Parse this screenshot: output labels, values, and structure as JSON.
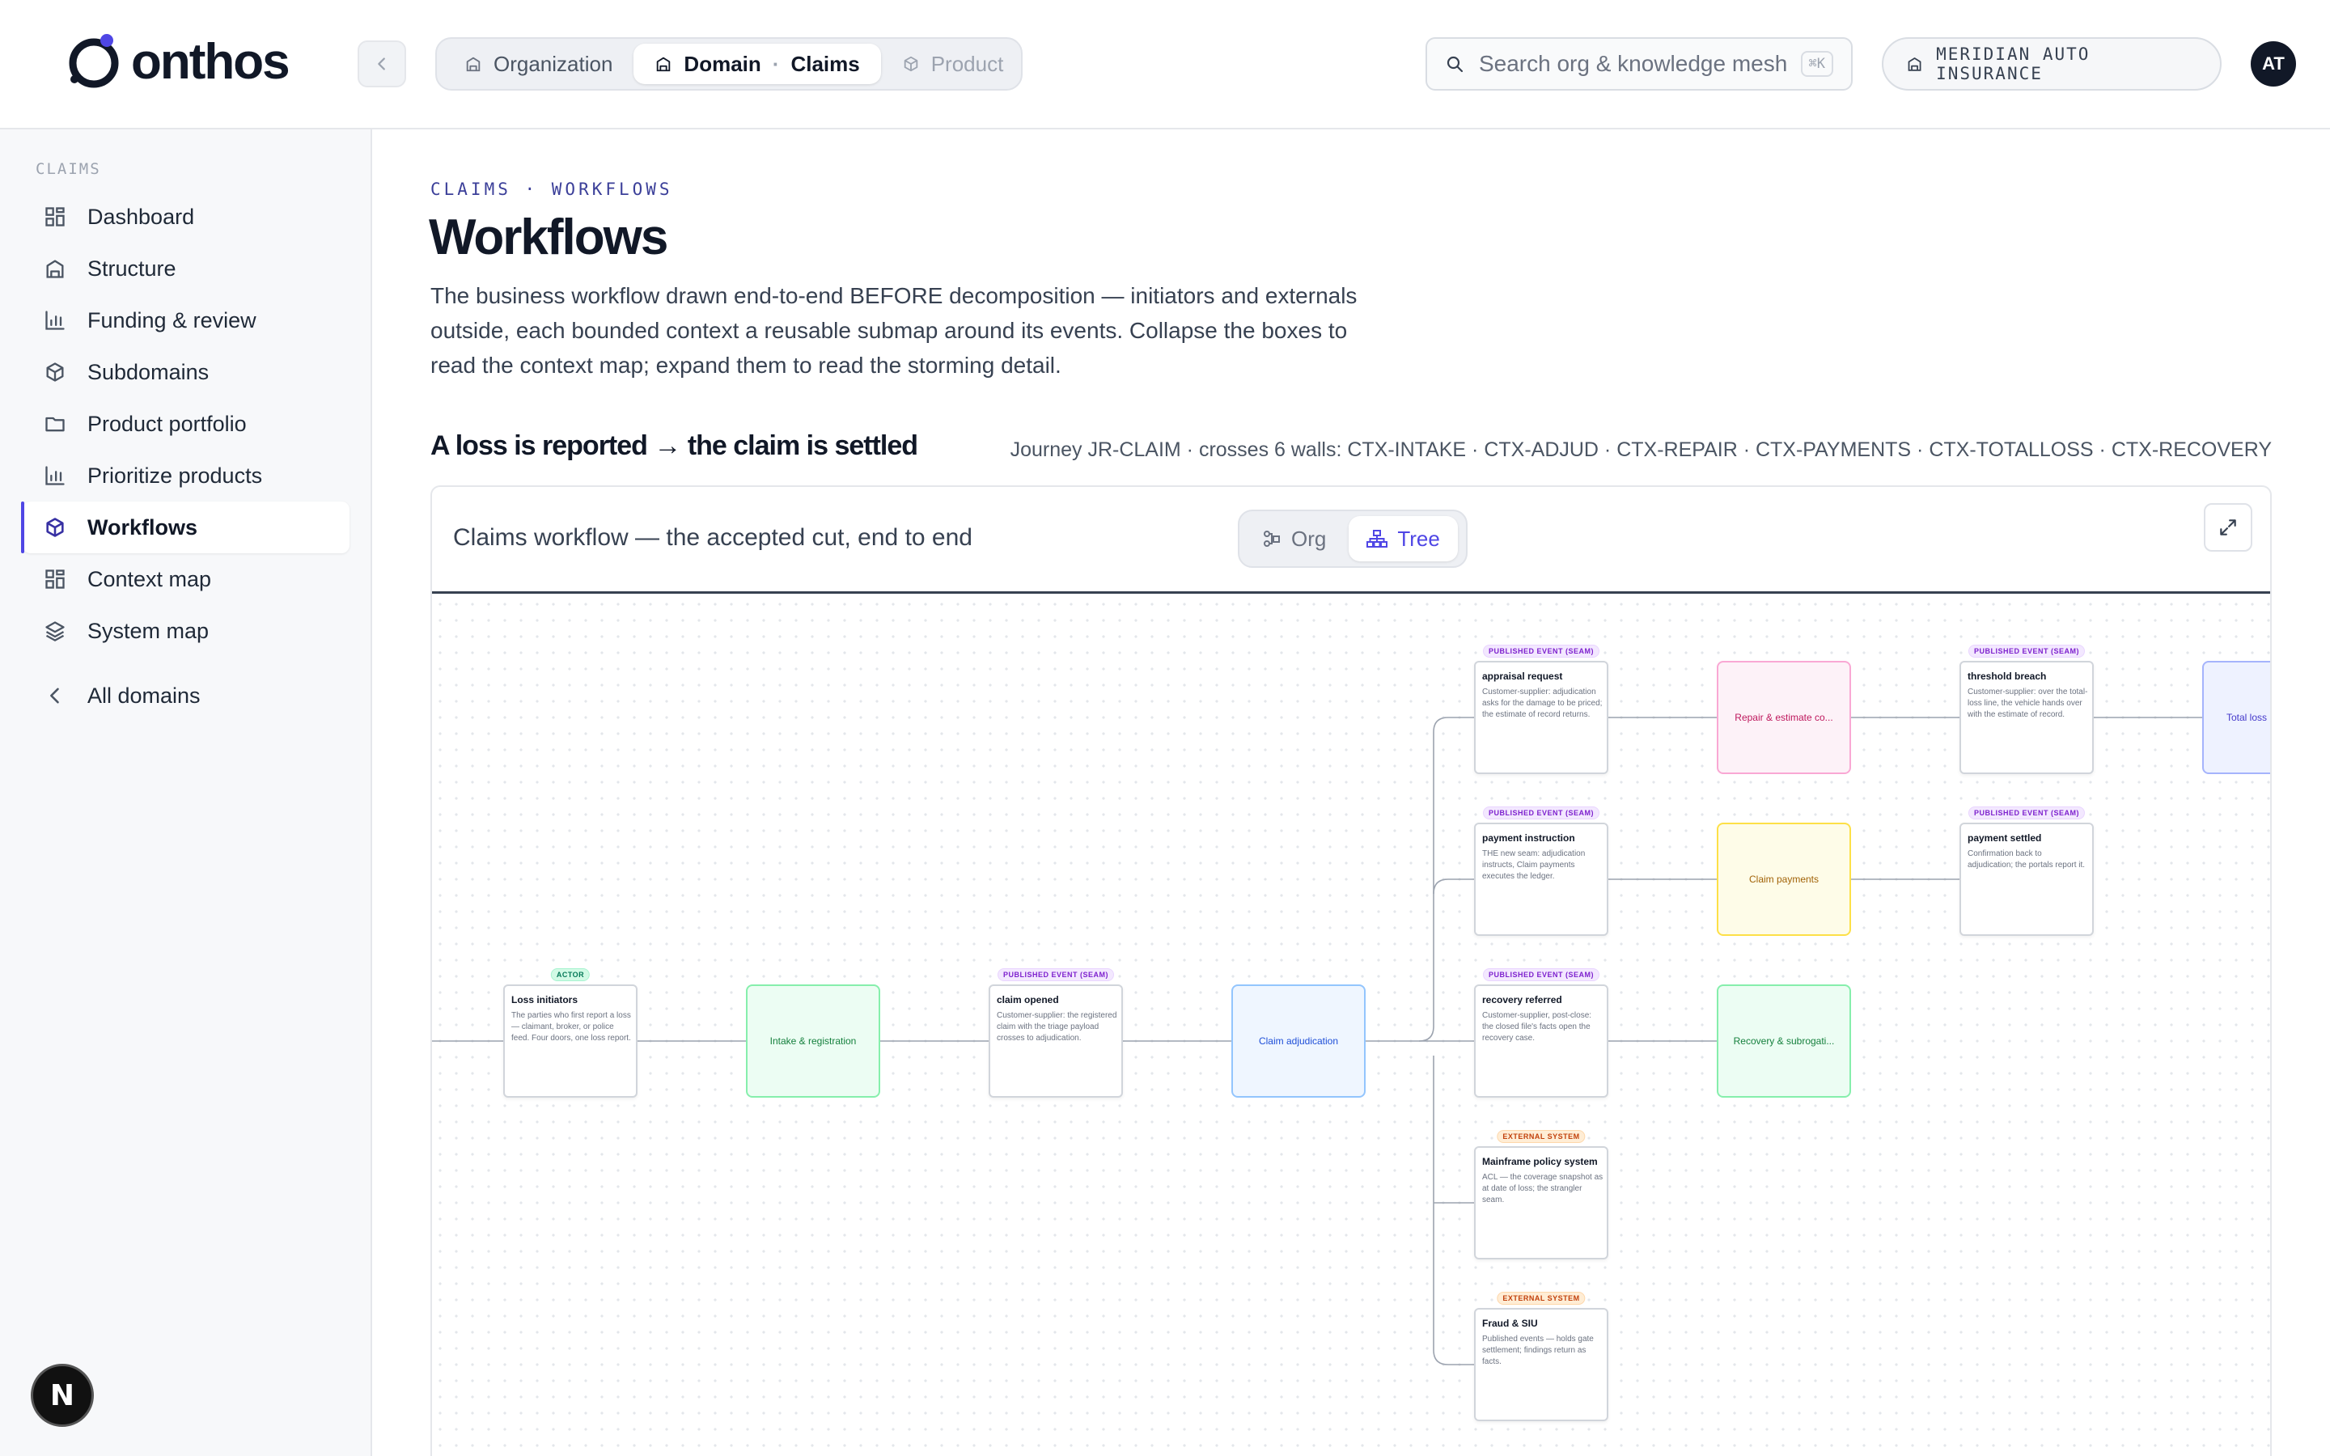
{
  "brand": {
    "name": "onthos"
  },
  "breadcrumbs": {
    "organization": "Organization",
    "domain": "Domain",
    "domain_value": "Claims",
    "product": "Product"
  },
  "search": {
    "placeholder": "Search org & knowledge mesh",
    "shortcut": "⌘K"
  },
  "org_pill": "MERIDIAN AUTO INSURANCE",
  "user": {
    "initials": "AT"
  },
  "sidebar": {
    "section": "CLAIMS",
    "items": [
      {
        "label": "Dashboard",
        "icon": "grid-icon"
      },
      {
        "label": "Structure",
        "icon": "building-icon"
      },
      {
        "label": "Funding & review",
        "icon": "bar-chart-icon"
      },
      {
        "label": "Subdomains",
        "icon": "cube-icon"
      },
      {
        "label": "Product portfolio",
        "icon": "folder-icon"
      },
      {
        "label": "Prioritize products",
        "icon": "bar-chart-icon"
      },
      {
        "label": "Workflows",
        "icon": "cube-icon",
        "active": true
      },
      {
        "label": "Context map",
        "icon": "grid-icon"
      },
      {
        "label": "System map",
        "icon": "layers-icon"
      }
    ],
    "all_domains": "All domains"
  },
  "page": {
    "eyebrow": "CLAIMS · WORKFLOWS",
    "title": "Workflows",
    "lede": "The business workflow drawn end-to-end BEFORE decomposition — initiators and externals outside, each bounded context a reusable submap around its events. Collapse the boxes to read the context map; expand them to read the storming detail.",
    "section_title": "A loss is reported → the claim is settled",
    "journey": "Journey JR-CLAIM · crosses 6 walls: CTX-INTAKE · CTX-ADJUD · CTX-REPAIR · CTX-PAYMENTS · CTX-TOTALLOSS · CTX-RECOVERY"
  },
  "panel": {
    "title": "Claims workflow — the accepted cut, end to end",
    "toggle": {
      "org": "Org",
      "tree": "Tree",
      "selected": "Tree"
    }
  },
  "workflow": {
    "nodes": {
      "loss_initiators": {
        "tag": "ACTOR",
        "title": "Loss initiators",
        "desc": "The parties who first report a loss — claimant, broker, or police feed. Four doors, one loss report."
      },
      "intake": {
        "label": "Intake & registration",
        "color": "#15803d"
      },
      "claim_opened": {
        "tag": "PUBLISHED EVENT (SEAM)",
        "title": "claim opened",
        "desc": "Customer-supplier: the registered claim with the triage payload crosses to adjudication."
      },
      "adjudication": {
        "label": "Claim adjudication",
        "color": "#1d4ed8"
      },
      "appraisal_request": {
        "tag": "PUBLISHED EVENT (SEAM)",
        "title": "appraisal request",
        "desc": "Customer-supplier: adjudication asks for the damage to be priced; the estimate of record returns."
      },
      "payment_instruction": {
        "tag": "PUBLISHED EVENT (SEAM)",
        "title": "payment instruction",
        "desc": "THE new seam: adjudication instructs, Claim payments executes the ledger."
      },
      "recovery_referred": {
        "tag": "PUBLISHED EVENT (SEAM)",
        "title": "recovery referred",
        "desc": "Customer-supplier, post-close: the closed file's facts open the recovery case."
      },
      "mainframe": {
        "tag": "EXTERNAL SYSTEM",
        "title": "Mainframe policy system",
        "desc": "ACL — the coverage snapshot as at date of loss; the strangler seam."
      },
      "fraud": {
        "tag": "EXTERNAL SYSTEM",
        "title": "Fraud & SIU",
        "desc": "Published events — holds gate settlement; findings return as facts."
      },
      "repair": {
        "label": "Repair & estimate co...",
        "color": "#be185d"
      },
      "payments": {
        "label": "Claim payments",
        "color": "#a16207"
      },
      "recovery": {
        "label": "Recovery & subrogati...",
        "color": "#15803d"
      },
      "threshold_breach": {
        "tag": "PUBLISHED EVENT (SEAM)",
        "title": "threshold breach",
        "desc": "Customer-supplier: over the total-loss line, the vehicle hands over with the estimate of record."
      },
      "payment_settled": {
        "tag": "PUBLISHED EVENT (SEAM)",
        "title": "payment settled",
        "desc": "Confirmation back to adjudication; the portals report it."
      },
      "total_loss": {
        "label": "Total loss i",
        "color": "#4338ca"
      }
    }
  },
  "colors": {
    "accent": "#4f46e5",
    "eyebrow": "#3b3f99"
  }
}
